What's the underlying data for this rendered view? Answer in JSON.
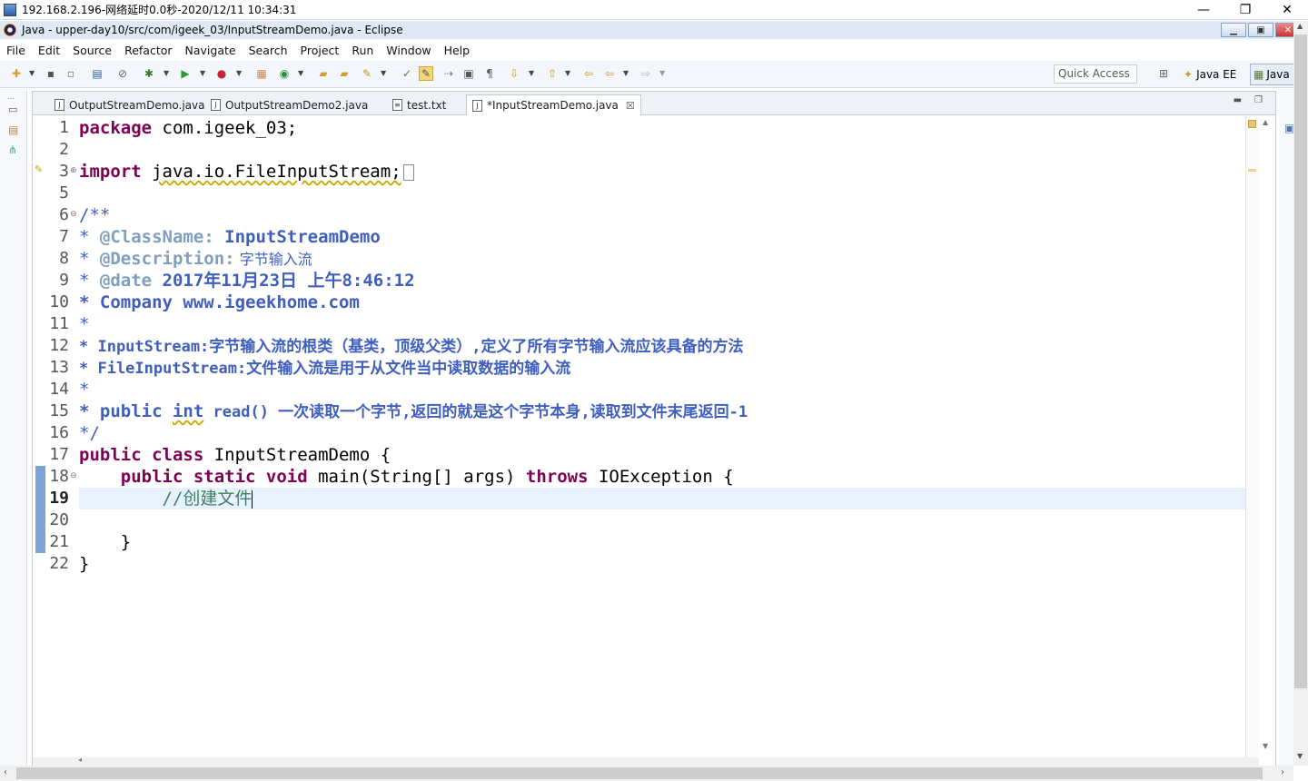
{
  "remote": {
    "title": "192.168.2.196-网络延时0.0秒-2020/12/11 10:34:31",
    "min_glyph": "—",
    "max_glyph": "❐",
    "close_glyph": "✕"
  },
  "window": {
    "title": "Java - upper-day10/src/com/igeek_03/InputStreamDemo.java - Eclipse"
  },
  "menu": [
    "File",
    "Edit",
    "Source",
    "Refactor",
    "Navigate",
    "Search",
    "Project",
    "Run",
    "Window",
    "Help"
  ],
  "toolbar": {
    "quick_access_placeholder": "Quick Access",
    "perspective_ee": "Java EE",
    "perspective_java": "Java"
  },
  "tabs": [
    {
      "label": "OutputStreamDemo.java",
      "icon": "java-file-icon",
      "active": false
    },
    {
      "label": "OutputStreamDemo2.java",
      "icon": "java-file-icon",
      "active": false
    },
    {
      "label": "test.txt",
      "icon": "text-file-icon",
      "active": false
    },
    {
      "label": "*InputStreamDemo.java",
      "icon": "java-file-icon",
      "active": true
    }
  ],
  "editor": {
    "current_line": 19,
    "line_numbers": [
      "1",
      "2",
      "3",
      "5",
      "6",
      "7",
      "8",
      "9",
      "10",
      "11",
      "12",
      "13",
      "14",
      "15",
      "16",
      "17",
      "18",
      "19",
      "20",
      "21",
      "22"
    ],
    "lines": {
      "l1_kw": "package",
      "l1_rest": " com.igeek_03;",
      "l3_kw": "import",
      "l3_rest": "java.io.FileInputStream;",
      "l6": "/**",
      "l7_star": "* ",
      "l7_tag": "@ClassName:",
      "l7_text": " InputStreamDemo",
      "l8_star": "* ",
      "l8_tag": "@Description:",
      "l8_text": " 字节输入流",
      "l9_star": "* ",
      "l9_tag": "@date",
      "l9_text": " 2017年11月23日 上午8:46:12",
      "l10": "* Company www.igeekhome.com",
      "l11": "*",
      "l12": "* InputStream:字节输入流的根类（基类，顶级父类）,定义了所有字节输入流应该具备的方法",
      "l13": "* FileInputStream:文件输入流是用于从文件当中读取数据的输入流",
      "l14": "*",
      "l15_a": "* public ",
      "l15_int": "int",
      "l15_b": " read() 一次读取一个字节,返回的就是这个字节本身,读取到文件末尾返回-1",
      "l16": "*/",
      "l17_kw": "public class",
      "l17_rest": " InputStreamDemo {",
      "l18_kw1": "public static void",
      "l18_mid": " main(String[] args) ",
      "l18_kw2": "throws",
      "l18_rest": " IOException {",
      "l19_comment": "//创建文件",
      "l21": "}",
      "l22": "}"
    }
  }
}
